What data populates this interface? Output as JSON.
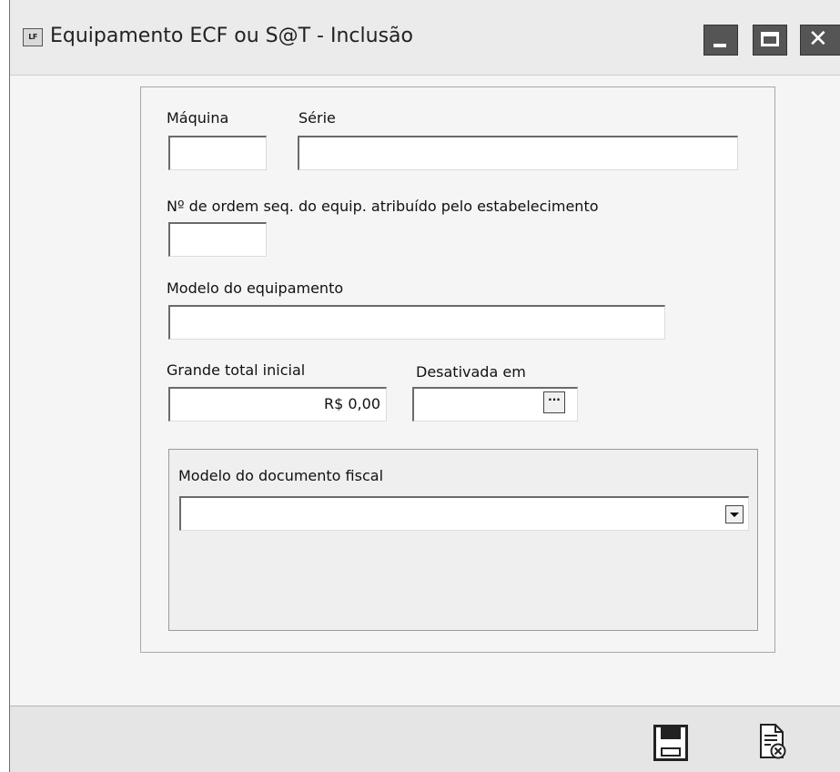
{
  "window": {
    "icon_text": "LF",
    "title": "Equipamento ECF ou S@T - Inclusão",
    "controls": [
      "minimize",
      "maximize",
      "close"
    ]
  },
  "form": {
    "maquina": {
      "label": "Máquina",
      "value": ""
    },
    "serie": {
      "label": "Série",
      "value": ""
    },
    "ordem": {
      "label": "Nº de ordem seq. do equip. atribuído pelo estabelecimento",
      "value": ""
    },
    "modelo_equipamento": {
      "label": "Modelo do equipamento",
      "value": ""
    },
    "grande_total": {
      "label": "Grande total inicial",
      "value": "R$ 0,00"
    },
    "desativada": {
      "label": "Desativada em",
      "value": "",
      "button_label": "···"
    },
    "modelo_documento": {
      "label": "Modelo do documento fiscal",
      "value": ""
    }
  },
  "footer": {
    "buttons": [
      {
        "name": "save",
        "icon": "floppy-disk-icon"
      },
      {
        "name": "cancel",
        "icon": "cancel-document-icon"
      }
    ]
  }
}
